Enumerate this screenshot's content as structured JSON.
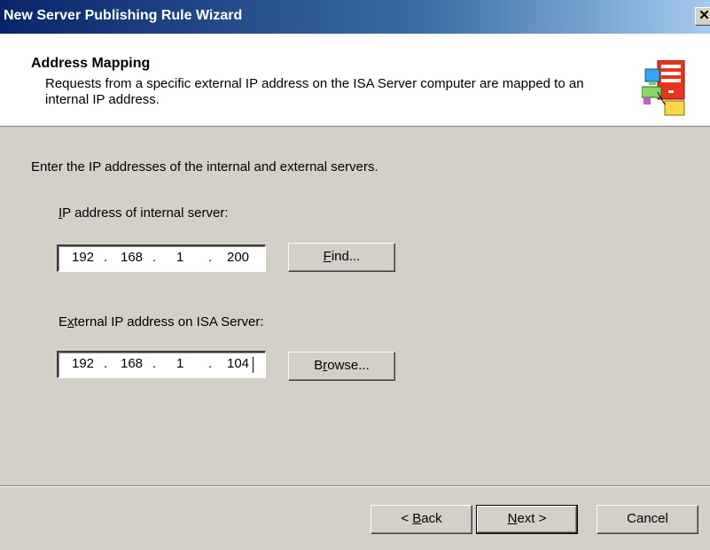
{
  "window": {
    "title": "New Server Publishing Rule Wizard",
    "close_glyph": "✕"
  },
  "header": {
    "title": "Address Mapping",
    "description": "Requests from a specific external IP address on the ISA Server computer are mapped to an internal IP address."
  },
  "body": {
    "instruction": "Enter the IP addresses of the internal and external servers.",
    "internal": {
      "label_accel": "I",
      "label_rest": "P address of internal server:",
      "octets": [
        "192",
        "168",
        "1",
        "200"
      ],
      "button_accel": "F",
      "button_rest": "ind..."
    },
    "external": {
      "label_pre": "E",
      "label_accel": "x",
      "label_rest": "ternal IP address on ISA Server:",
      "octets": [
        "192",
        "168",
        "1",
        "104"
      ],
      "button_pre": "B",
      "button_accel": "r",
      "button_rest": "owse..."
    }
  },
  "footer": {
    "back_pre": "< ",
    "back_accel": "B",
    "back_rest": "ack",
    "next_accel": "N",
    "next_rest": "ext >",
    "cancel": "Cancel"
  },
  "icons": {
    "header": "server-publishing-icon"
  },
  "colors": {
    "title_bar": "#0a246a",
    "dialog_bg": "#d4d0c8"
  }
}
